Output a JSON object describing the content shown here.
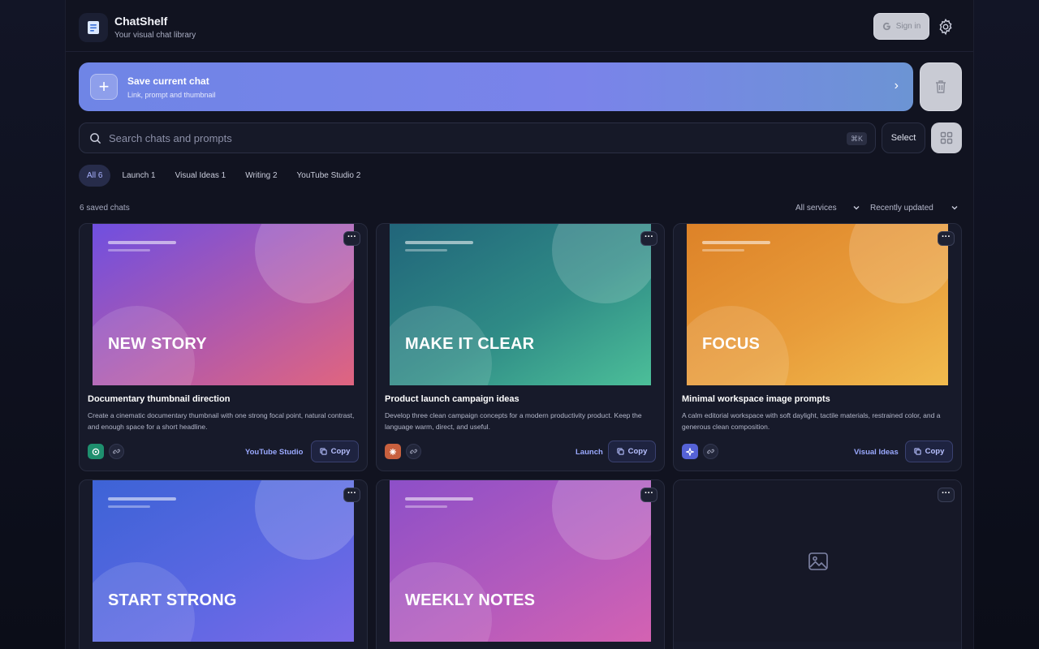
{
  "app": {
    "title": "ChatShelf",
    "subtitle": "Your visual chat library"
  },
  "header": {
    "signin_label": "Sign in"
  },
  "save_banner": {
    "title": "Save current chat",
    "subtitle": "Link, prompt and thumbnail"
  },
  "search": {
    "placeholder": "Search chats and prompts",
    "shortcut": "⌘K"
  },
  "toolbar": {
    "select_label": "Select"
  },
  "tabs": [
    {
      "label": "All 6",
      "active": true
    },
    {
      "label": "Launch 1",
      "active": false
    },
    {
      "label": "Visual Ideas 1",
      "active": false
    },
    {
      "label": "Writing 2",
      "active": false
    },
    {
      "label": "YouTube Studio 2",
      "active": false
    }
  ],
  "count_label": "6 saved chats",
  "filters": {
    "service": "All services",
    "sort": "Recently updated"
  },
  "cards": [
    {
      "headline": "NEW STORY",
      "title": "Documentary thumbnail direction",
      "description": "Create a cinematic documentary thumbnail with one strong focal point, natural contrast, and enough space for a short headline.",
      "tag": "YouTube Studio",
      "copy_label": "Copy",
      "gradient": [
        "#6f4fe0",
        "#e0657f"
      ],
      "service_icon": "green-service-icon",
      "service_color": "#1e8f6e"
    },
    {
      "headline": "MAKE IT CLEAR",
      "title": "Product launch campaign ideas",
      "description": "Develop three clean campaign concepts for a modern productivity product. Keep the language warm, direct, and useful.",
      "tag": "Launch",
      "copy_label": "Copy",
      "gradient": [
        "#21657a",
        "#4cbf99"
      ],
      "service_icon": "asterisk-service-icon",
      "service_color": "#c8603e"
    },
    {
      "headline": "FOCUS",
      "title": "Minimal workspace image prompts",
      "description": "A calm editorial workspace with soft daylight, tactile materials, restrained color, and a generous clean composition.",
      "tag": "Visual Ideas",
      "copy_label": "Copy",
      "gradient": [
        "#dd8228",
        "#f1bb4e"
      ],
      "service_icon": "sparkle-service-icon",
      "service_color": "#5562d6"
    },
    {
      "headline": "START STRONG",
      "gradient": [
        "#3d63d6",
        "#7a6ae8"
      ]
    },
    {
      "headline": "WEEKLY NOTES",
      "gradient": [
        "#8d4fc8",
        "#d462b2"
      ]
    },
    {
      "headline": "",
      "gradient": null
    }
  ]
}
